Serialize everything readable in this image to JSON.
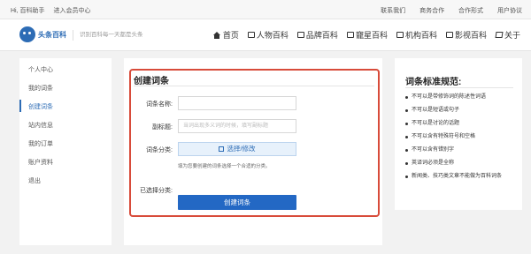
{
  "topbar": {
    "left": [
      "Hi, 百科助手",
      "进入会员中心"
    ],
    "right": [
      "联系我们",
      "商务合作",
      "合作形式",
      "用户协议"
    ]
  },
  "header": {
    "logo_text": "头条百科",
    "slogan": "识别百科每一天都是头条",
    "nav": [
      {
        "label": "首页",
        "icon": "home-icon"
      },
      {
        "label": "人物百科",
        "icon": "id-card-icon"
      },
      {
        "label": "品牌百科",
        "icon": "id-card-icon"
      },
      {
        "label": "寵星百科",
        "icon": "id-card-icon"
      },
      {
        "label": "机构百科",
        "icon": "id-card-icon"
      },
      {
        "label": "影视百科",
        "icon": "id-card-icon"
      },
      {
        "label": "关于",
        "icon": "book-icon"
      }
    ]
  },
  "sidebar": {
    "items": [
      "个人中心",
      "我的词条",
      "创建词条",
      "站内信息",
      "我的订单",
      "账户资料",
      "退出"
    ],
    "active_index": 2
  },
  "form": {
    "title": "创建词条",
    "name_label": "词条名称:",
    "name_value": "",
    "subtitle_label": "副标题:",
    "subtitle_placeholder": "当词出现多义词的时候，填写副标题",
    "category_label": "词条分类:",
    "category_button": "选择/修改",
    "category_hint": "填为您要创建的词条选择一个合适的分类。",
    "selected_label": "已选择分类:",
    "submit_label": "创建词条"
  },
  "rules": {
    "title": "词条标准规范:",
    "items": [
      "不可以是带修饰词的陈述性词语",
      "不可以是短语或句子",
      "不可以是讨论的话题",
      "不可以含有特殊符号和空格",
      "不可以含有错别字",
      "英译词必须是全称",
      "新闻类、技巧类文章不能做为百科词条"
    ]
  },
  "colors": {
    "accent": "#2d6cb5",
    "highlight_frame": "#d84b3a",
    "submit_bg": "#2368c4"
  }
}
